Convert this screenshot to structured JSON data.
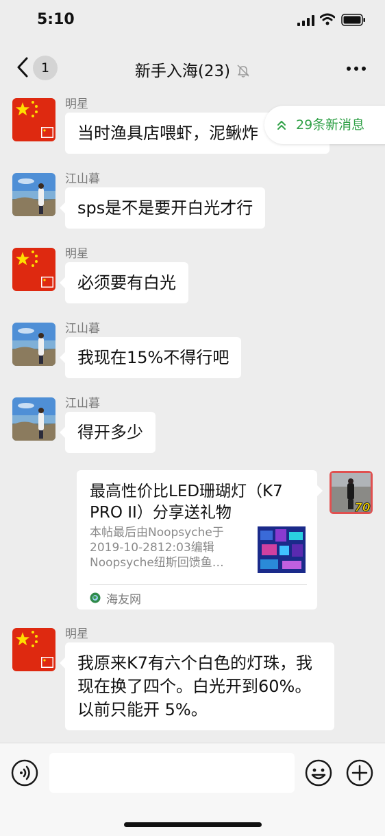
{
  "status_bar": {
    "time": "5:10"
  },
  "nav": {
    "back_badge": "1",
    "title": "新手入海(23)",
    "icons": [
      "back-icon",
      "mute-bell-icon",
      "more-icon"
    ]
  },
  "new_messages_pill": {
    "label": "29条新消息"
  },
  "messages": [
    {
      "sender": "明星",
      "avatar": "china-flag-avatar",
      "text": "当时渔具店喂虾，泥鳅炸"
    },
    {
      "sender": "江山暮",
      "avatar": "seaside-photo-avatar",
      "text": "sps是不是要开白光才行"
    },
    {
      "sender": "明星",
      "avatar": "china-flag-avatar",
      "text": "必须要有白光"
    },
    {
      "sender": "江山暮",
      "avatar": "seaside-photo-avatar",
      "text": "我现在15%不得行吧"
    },
    {
      "sender": "江山暮",
      "avatar": "seaside-photo-avatar",
      "text": "得开多少"
    },
    {
      "sender": "明星",
      "avatar": "china-flag-avatar",
      "text": "我原来K7有六个白色的灯珠，我现在换了四个。白光开到60%。以前只能开 5%。"
    }
  ],
  "link_card": {
    "title": "最高性价比LED珊瑚灯（K7 PRO II）分享送礼物",
    "description": "本帖最后由Noopsyche于2019-10-2812:03编辑Noopsyche纽斯回馈鱼…",
    "source": "海友网",
    "avatar_badge": "70"
  },
  "input_bar": {
    "placeholder": "",
    "icons": [
      "voice-icon",
      "emoji-icon",
      "plus-icon"
    ]
  },
  "colors": {
    "accent_green": "#2fa046",
    "background": "#ededed",
    "bubble": "#ffffff",
    "flag_red": "#de2910",
    "flag_yellow": "#ffde00"
  }
}
